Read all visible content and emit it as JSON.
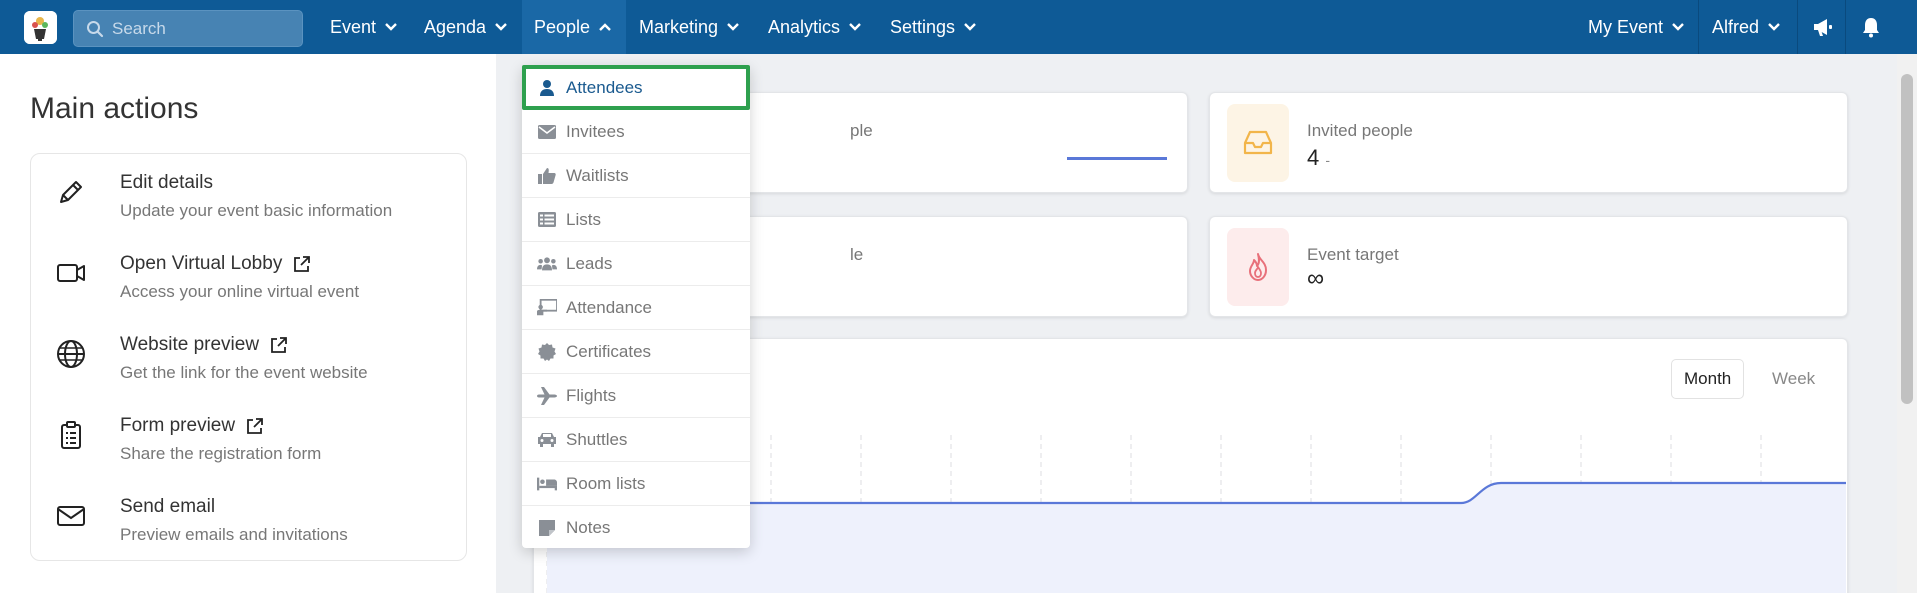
{
  "nav": {
    "search_placeholder": "Search",
    "items": [
      {
        "label": "Event"
      },
      {
        "label": "Agenda"
      },
      {
        "label": "People"
      },
      {
        "label": "Marketing"
      },
      {
        "label": "Analytics"
      },
      {
        "label": "Settings"
      }
    ],
    "event_selector": "My Event",
    "user": "Alfred",
    "icons": [
      "megaphone-icon",
      "bell-icon"
    ]
  },
  "main": {
    "title": "Main actions",
    "actions": [
      {
        "title": "Edit details",
        "desc": "Update your event basic information",
        "icon": "pencil-icon",
        "external": false
      },
      {
        "title": "Open Virtual Lobby",
        "desc": "Access your online virtual event",
        "icon": "video-icon",
        "external": true
      },
      {
        "title": "Website preview",
        "desc": "Get the link for the event website",
        "icon": "globe-icon",
        "external": true
      },
      {
        "title": "Form preview",
        "desc": "Share the registration form",
        "icon": "clipboard-icon",
        "external": true
      },
      {
        "title": "Send email",
        "desc": "Preview emails and invitations",
        "icon": "envelope-icon",
        "external": false
      }
    ]
  },
  "stats": {
    "card1_label_fragment": "ple",
    "card2": {
      "label": "Invited people",
      "value": "4",
      "suffix": "-"
    },
    "card3_label_fragment": "le",
    "card4": {
      "label": "Event target",
      "value": "∞"
    }
  },
  "chart": {
    "toggle": [
      "Month",
      "Week"
    ],
    "active": "Month"
  },
  "dropdown": {
    "items": [
      {
        "label": "Attendees",
        "icon": "user-icon"
      },
      {
        "label": "Invitees",
        "icon": "envelope-icon"
      },
      {
        "label": "Waitlists",
        "icon": "thumbs-up-icon"
      },
      {
        "label": "Lists",
        "icon": "list-icon"
      },
      {
        "label": "Leads",
        "icon": "users-icon"
      },
      {
        "label": "Attendance",
        "icon": "chalkboard-icon"
      },
      {
        "label": "Certificates",
        "icon": "certificate-icon"
      },
      {
        "label": "Flights",
        "icon": "plane-icon"
      },
      {
        "label": "Shuttles",
        "icon": "car-icon"
      },
      {
        "label": "Room lists",
        "icon": "bed-icon"
      },
      {
        "label": "Notes",
        "icon": "note-icon"
      }
    ],
    "selected": "Attendees"
  },
  "colors": {
    "nav_bg": "#0e5a96",
    "accent_green": "#2ea04e",
    "chart_line": "#5a78d8",
    "chart_fill": "#eef1fc"
  }
}
